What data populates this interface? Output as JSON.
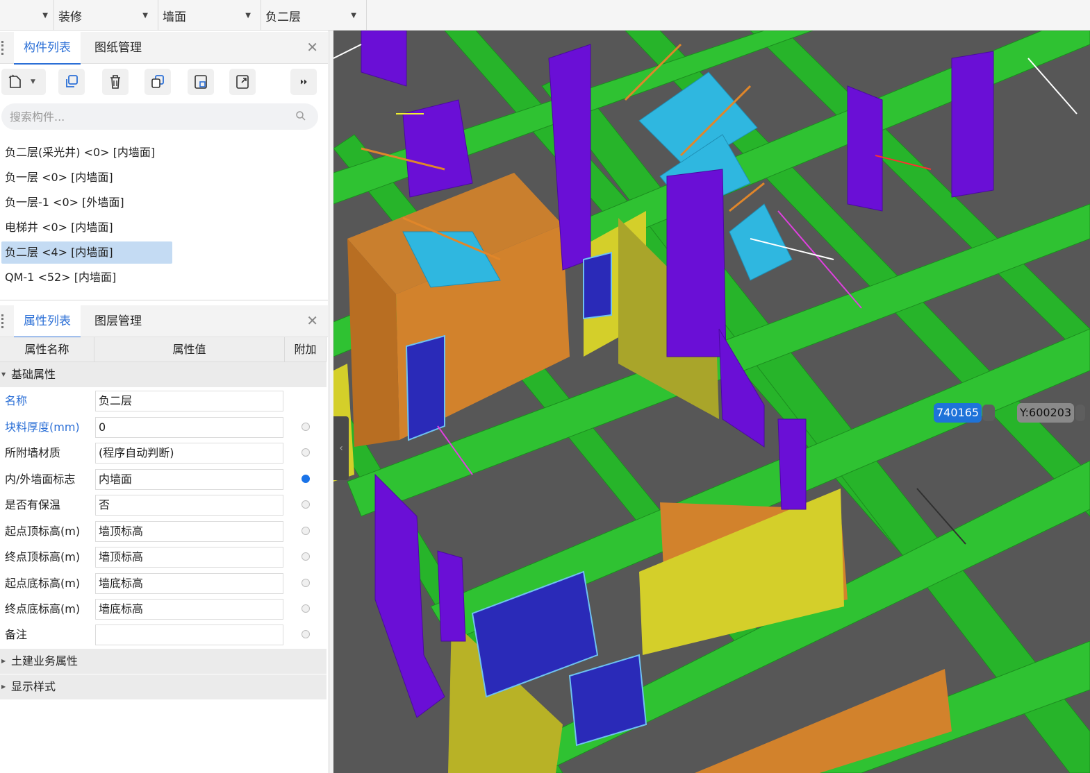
{
  "topbar": {
    "dropdowns": [
      {
        "label": ""
      },
      {
        "label": "装修"
      },
      {
        "label": "墙面"
      },
      {
        "label": "负二层"
      }
    ]
  },
  "component_panel": {
    "tabs": [
      {
        "label": "构件列表"
      },
      {
        "label": "图纸管理"
      }
    ],
    "toolbar_icons": [
      "new-icon",
      "copy-icon",
      "delete-icon",
      "duplicate-icon",
      "save-template-icon",
      "export-icon",
      "more-icon"
    ],
    "search": {
      "placeholder": "搜索构件...",
      "value": ""
    },
    "items": [
      {
        "label": "负二层(采光井) <0> [内墙面]"
      },
      {
        "label": "负一层 <0> [内墙面]"
      },
      {
        "label": "负一层-1 <0> [外墙面]"
      },
      {
        "label": "电梯井 <0> [内墙面]"
      },
      {
        "label": "负二层 <4> [内墙面]"
      },
      {
        "label": "QM-1 <52> [内墙面]"
      }
    ],
    "selected_index": 4
  },
  "property_panel": {
    "tabs": [
      {
        "label": "属性列表"
      },
      {
        "label": "图层管理"
      }
    ],
    "columns": [
      {
        "label": "属性名称"
      },
      {
        "label": "属性值"
      },
      {
        "label": "附加"
      }
    ],
    "groups": [
      {
        "label": "基础属性"
      },
      {
        "label": "土建业务属性"
      },
      {
        "label": "显示样式"
      }
    ],
    "rows": [
      {
        "name": "名称",
        "value": "负二层",
        "radio": "none"
      },
      {
        "name": "块料厚度(mm)",
        "value": "0",
        "radio": "off"
      },
      {
        "name": "所附墙材质",
        "value": "(程序自动判断)",
        "radio": "off"
      },
      {
        "name": "内/外墙面标志",
        "value": "内墙面",
        "radio": "on"
      },
      {
        "name": "是否有保温",
        "value": "否",
        "radio": "off"
      },
      {
        "name": "起点顶标高(m)",
        "value": "墙顶标高",
        "radio": "off"
      },
      {
        "name": "终点顶标高(m)",
        "value": "墙顶标高",
        "radio": "off"
      },
      {
        "name": "起点底标高(m)",
        "value": "墙底标高",
        "radio": "off"
      },
      {
        "name": "终点底标高(m)",
        "value": "墙底标高",
        "radio": "off"
      },
      {
        "name": "备注",
        "value": "",
        "radio": "off"
      }
    ]
  },
  "viewport": {
    "coord_x": "740165",
    "coord_y": "Y:600203",
    "colors": {
      "floor": "#575757",
      "beam": "#27b42a",
      "column": "#6a0fd6",
      "wall_orange": "#d2822c",
      "wall_yellow": "#d4cf2a",
      "stair": "#2fb7e0",
      "window": "#2a2ab8"
    }
  }
}
